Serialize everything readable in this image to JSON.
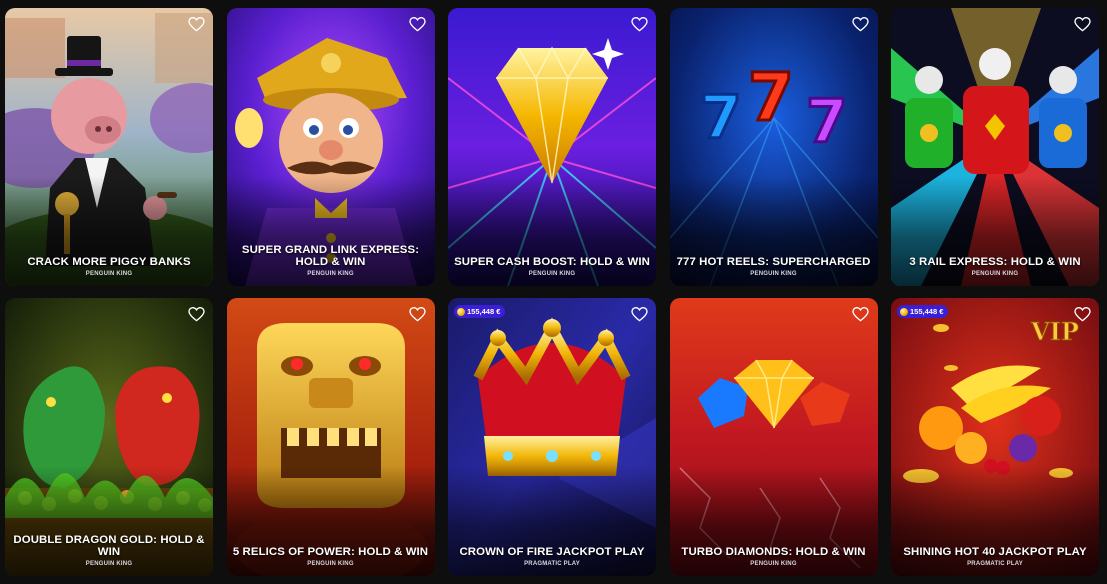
{
  "games": [
    {
      "title": "CRACK MORE PIGGY BANKS",
      "provider": "PENGUIN KING",
      "jackpot": "",
      "icon": "pig-tycoon-art",
      "accent": "#2f6b1f"
    },
    {
      "title": "SUPER GRAND LINK EXPRESS: HOLD & WIN",
      "provider": "PENGUIN KING",
      "jackpot": "",
      "icon": "conductor-art",
      "accent": "#6b1fd6"
    },
    {
      "title": "SUPER CASH BOOST: HOLD & WIN",
      "provider": "PENGUIN KING",
      "jackpot": "",
      "icon": "diamond-art",
      "accent": "#2a0f8f"
    },
    {
      "title": "777 HOT REELS: SUPERCHARGED",
      "provider": "PENGUIN KING",
      "jackpot": "",
      "icon": "sevens-art",
      "accent": "#0c2a8a"
    },
    {
      "title": "3 RAIL EXPRESS: HOLD & WIN",
      "provider": "PENGUIN KING",
      "jackpot": "",
      "icon": "trains-art",
      "accent": "#1a1a3a"
    },
    {
      "title": "DOUBLE DRAGON GOLD: HOLD & WIN",
      "provider": "PENGUIN KING",
      "jackpot": "",
      "icon": "dragons-art",
      "accent": "#1f3a12"
    },
    {
      "title": "5 RELICS OF POWER: HOLD & WIN",
      "provider": "PENGUIN KING",
      "jackpot": "",
      "icon": "golden-idol-art",
      "accent": "#a83212"
    },
    {
      "title": "CROWN OF FIRE JACKPOT PLAY",
      "provider": "PRAGMATIC PLAY",
      "jackpot": "155,448 €",
      "icon": "crown-art",
      "accent": "#14145a"
    },
    {
      "title": "TURBO DIAMONDS: HOLD & WIN",
      "provider": "PENGUIN KING",
      "jackpot": "",
      "icon": "gems-art",
      "accent": "#b8141c"
    },
    {
      "title": "SHINING HOT 40 JACKPOT PLAY",
      "provider": "PRAGMATIC PLAY",
      "jackpot": "155,448 €",
      "icon": "fruits-vip-art",
      "accent": "#a0101a"
    }
  ],
  "favorite_icon": "heart-outline-icon"
}
